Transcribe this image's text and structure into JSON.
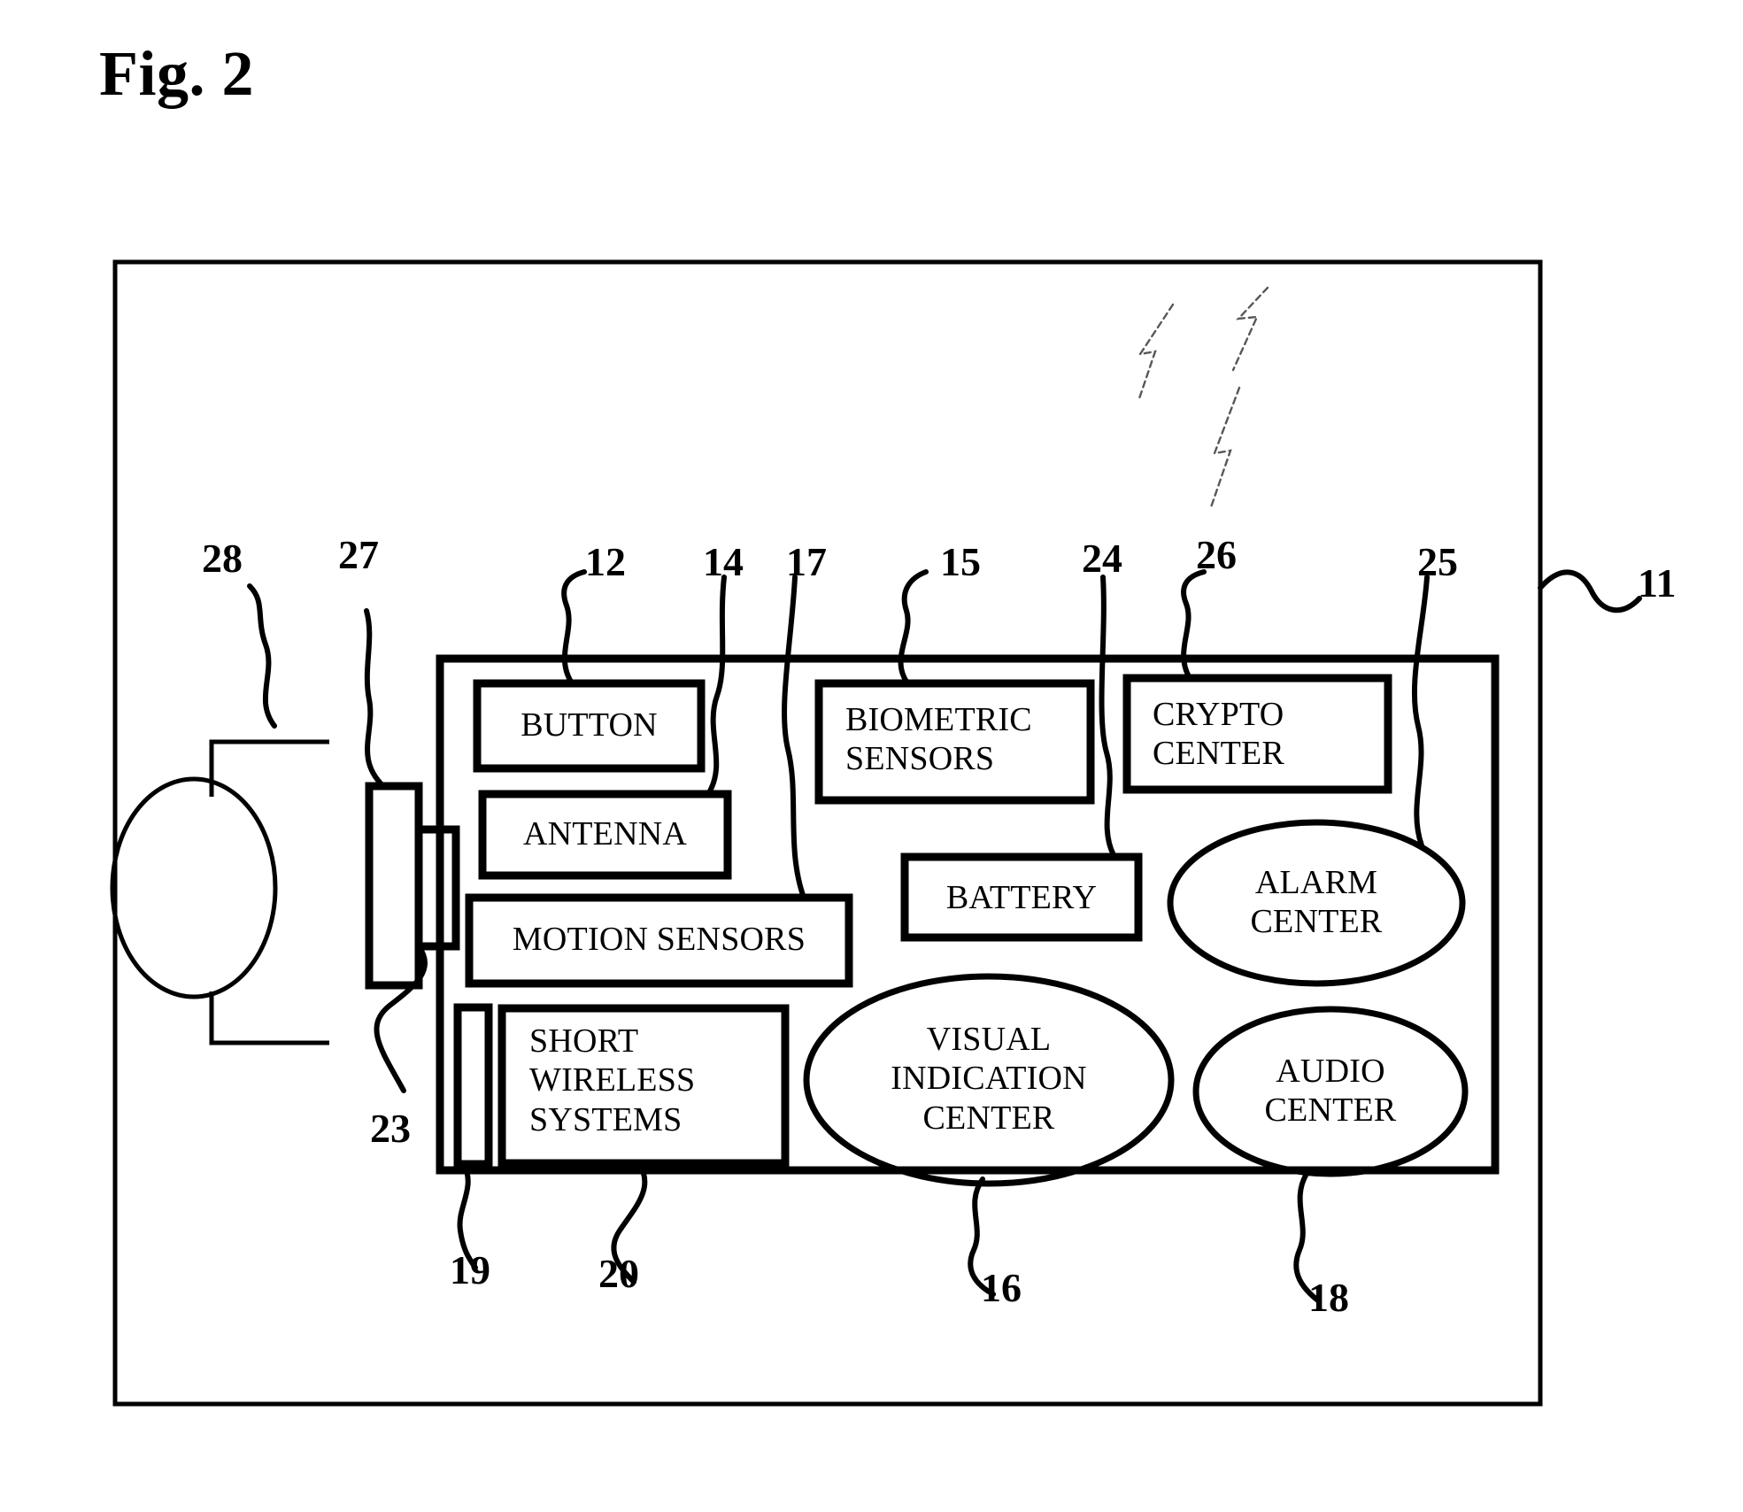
{
  "figure": {
    "title": "Fig. 2",
    "type": "patent-block-diagram"
  },
  "outer_frame": {
    "name": "outer-enclosure",
    "ref": "11"
  },
  "device_frame": {
    "name": "device-body",
    "ref": ""
  },
  "blocks": [
    {
      "id": "button",
      "label": "BUTTON",
      "ref": "12",
      "shape": "rect",
      "align": "center"
    },
    {
      "id": "antenna",
      "label": "ANTENNA",
      "ref": "14",
      "shape": "rect",
      "align": "center"
    },
    {
      "id": "motion_sensors",
      "label": "MOTION SENSORS",
      "ref": "17",
      "shape": "rect",
      "align": "center"
    },
    {
      "id": "biometric_sensors",
      "label": "BIOMETRIC\nSENSORS",
      "ref": "15",
      "shape": "rect",
      "align": "left"
    },
    {
      "id": "crypto_center",
      "label": "CRYPTO\nCENTER",
      "ref": "26",
      "shape": "rect",
      "align": "left"
    },
    {
      "id": "battery",
      "label": "BATTERY",
      "ref": "24",
      "shape": "rect",
      "align": "center"
    },
    {
      "id": "short_wireless",
      "label": "SHORT\nWIRELESS\nSYSTEMS",
      "ref": "20",
      "shape": "rect",
      "align": "left"
    },
    {
      "id": "alarm_center",
      "label": "ALARM\nCENTER",
      "ref": "25",
      "shape": "ellipse",
      "align": "center"
    },
    {
      "id": "visual_center",
      "label": "VISUAL\nINDICATION\nCENTER",
      "ref": "16",
      "shape": "ellipse",
      "align": "center"
    },
    {
      "id": "audio_center",
      "label": "AUDIO\nCENTER",
      "ref": "18",
      "shape": "ellipse",
      "align": "center"
    },
    {
      "id": "card_slot",
      "label": "",
      "ref": "19",
      "shape": "rect",
      "align": "center"
    },
    {
      "id": "connector_body",
      "label": "",
      "ref": "27",
      "shape": "rect",
      "align": "center"
    },
    {
      "id": "connector_tab",
      "label": "",
      "ref": "23",
      "shape": "rect",
      "align": "center"
    },
    {
      "id": "external_token",
      "label": "",
      "ref": "28",
      "shape": "ellipse",
      "align": "center"
    }
  ],
  "refs": {
    "r28": "28",
    "r27": "27",
    "r12": "12",
    "r14": "14",
    "r17": "17",
    "r15": "15",
    "r24": "24",
    "r26": "26",
    "r25": "25",
    "r11": "11",
    "r23": "23",
    "r19": "19",
    "r20": "20",
    "r16": "16",
    "r18": "18"
  },
  "labels": {
    "button": "BUTTON",
    "antenna": "ANTENNA",
    "motion_sensors": "MOTION SENSORS",
    "biometric_sensors": "BIOMETRIC\nSENSORS",
    "crypto_center": "CRYPTO\nCENTER",
    "battery": "BATTERY",
    "short_wireless": "SHORT\nWIRELESS\nSYSTEMS",
    "alarm_center": "ALARM\nCENTER",
    "visual_center": "VISUAL\nINDICATION\nCENTER",
    "audio_center": "AUDIO\nCENTER"
  },
  "symbols": {
    "wireless_bolts": 3,
    "bolt_name": "lightning-bolt-icon"
  },
  "colors": {
    "ink": "#000000",
    "paper": "#ffffff"
  }
}
